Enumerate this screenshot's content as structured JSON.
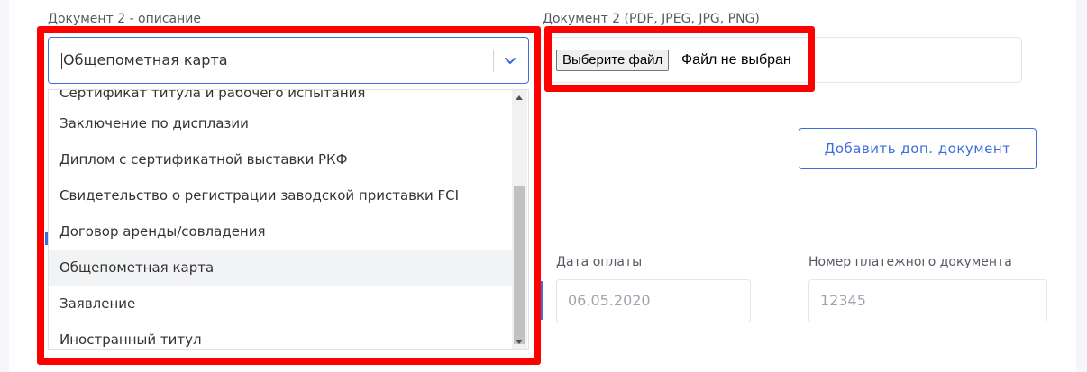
{
  "form": {
    "doc2_description_label": "Документ 2 - описание",
    "doc2_file_label": "Документ 2 (PDF, JPEG, JPG, PNG)",
    "select_value": "Общепометная карта",
    "file_button_label": "Выберите файл",
    "file_status": "Файл не выбран",
    "add_doc_button_label": "Добавить доп. документ",
    "payment_date_label": "Дата оплаты",
    "payment_date_value": "06.05.2020",
    "payment_doc_number_label": "Номер платежного документа",
    "payment_doc_number_value": "12345"
  },
  "dropdown": {
    "items": [
      {
        "label": "Сертификат титула и рабочего испытания"
      },
      {
        "label": "Заключение по дисплазии"
      },
      {
        "label": "Диплом с сертификатной выставки РКФ"
      },
      {
        "label": "Свидетельство о регистрации заводской приставки FCI"
      },
      {
        "label": "Договор аренды/совладения"
      },
      {
        "label": "Общепометная карта",
        "selected": true
      },
      {
        "label": "Заявление"
      },
      {
        "label": "Иностранный титул"
      }
    ]
  },
  "colors": {
    "accent": "#3d6ee0",
    "highlight": "#ff0000"
  }
}
